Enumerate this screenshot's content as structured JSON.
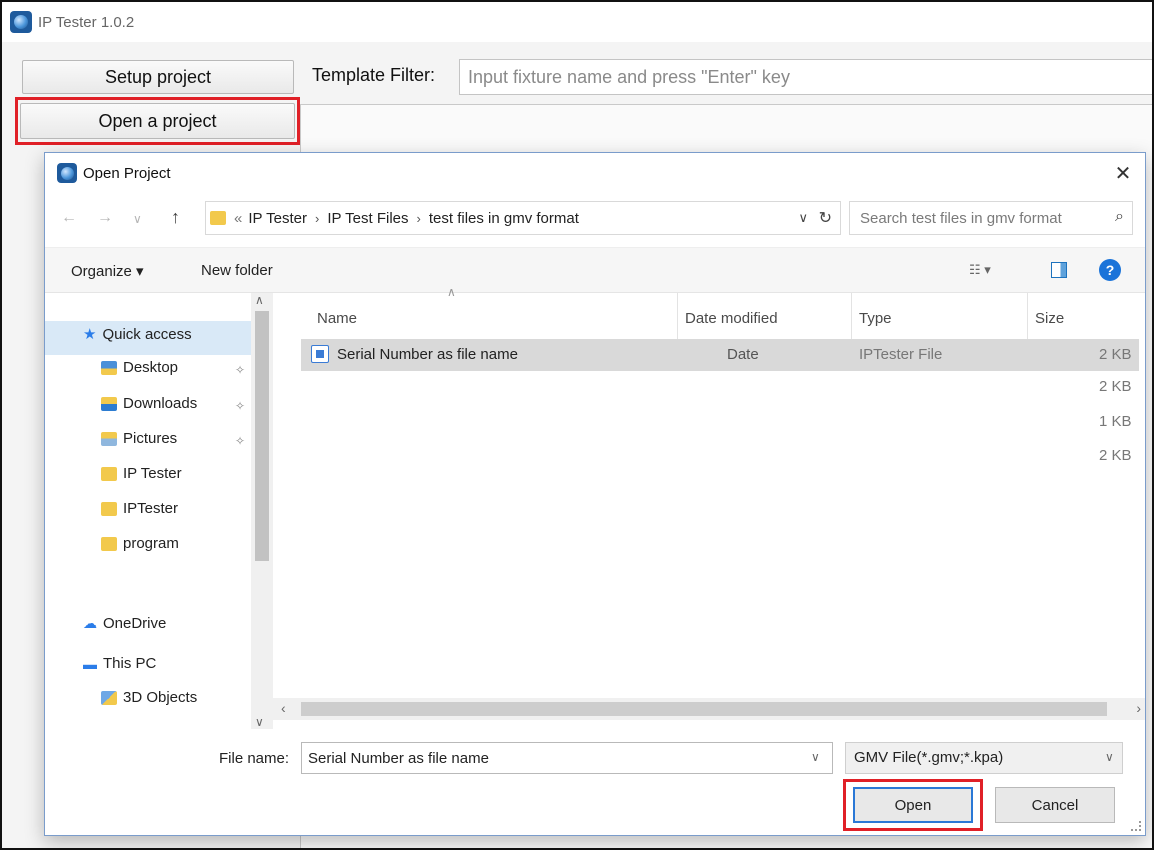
{
  "app": {
    "title": "IP Tester 1.0.2",
    "setup_label": "Setup project",
    "open_label": "Open a project",
    "template_filter_label": "Template Filter:",
    "template_filter_placeholder": "Input fixture name and press \"Enter\" key"
  },
  "dialog": {
    "title": "Open Project",
    "close_glyph": "✕",
    "breadcrumb": {
      "prefix": "«",
      "crumbs": [
        "IP Tester",
        "IP Test Files",
        "test files in gmv format"
      ],
      "separator": "›"
    },
    "search_placeholder": "Search test files in gmv format",
    "toolbar": {
      "organize": "Organize ▾",
      "new_folder": "New folder",
      "help": "?"
    },
    "nav": {
      "quick_access": "Quick access",
      "items": [
        "Desktop",
        "Downloads",
        "Pictures",
        "IP Tester",
        "IPTester",
        "program"
      ],
      "onedrive": "OneDrive",
      "this_pc": "This PC",
      "objects3d": "3D Objects"
    },
    "columns": {
      "name": "Name",
      "date": "Date modified",
      "type": "Type",
      "size": "Size"
    },
    "file": {
      "name": "Serial Number as file name",
      "date": "Date",
      "type": "IPTester File",
      "size": "2 KB"
    },
    "extra_sizes": [
      "2 KB",
      "1 KB",
      "2 KB"
    ],
    "filename_label": "File name:",
    "filename_value": "Serial Number as file name",
    "filetype": "GMV File(*.gmv;*.kpa)",
    "open_button": "Open",
    "cancel_button": "Cancel"
  },
  "colors": {
    "highlight": "#e02027",
    "accent": "#2a78d6",
    "selection": "#d9d9d9"
  }
}
